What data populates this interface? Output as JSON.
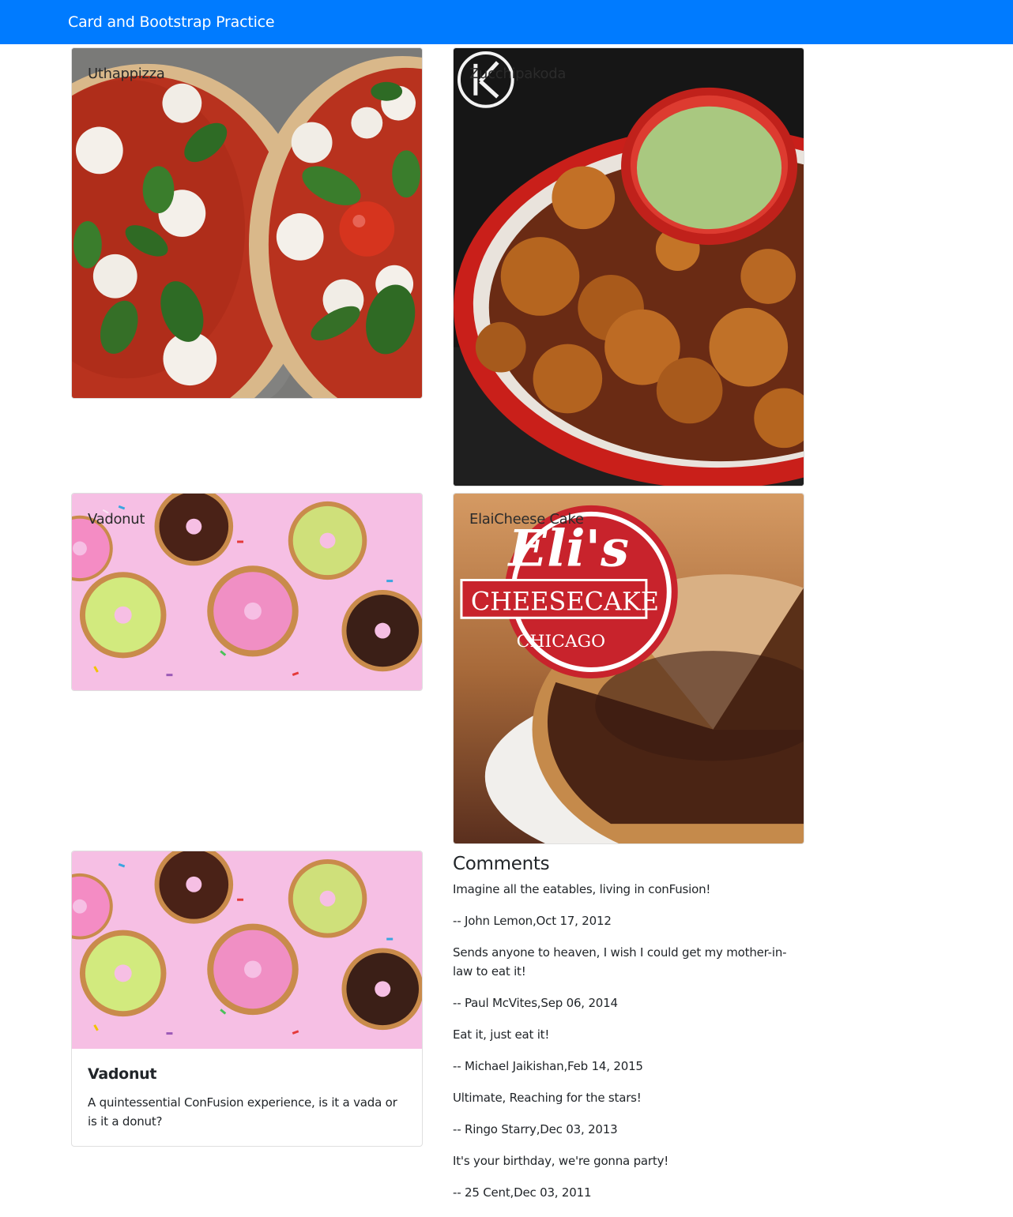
{
  "navbar": {
    "brand": "Card and Bootstrap Practice"
  },
  "cards": {
    "uthappizza": {
      "title": "Uthappizza"
    },
    "zucchipakoda": {
      "title": "Zucchipakoda"
    },
    "vadonut": {
      "title": "Vadonut"
    },
    "elaicheese": {
      "title": "ElaiCheese Cake"
    },
    "vadonut_detail": {
      "title": "Vadonut",
      "description": "A quintessential ConFusion experience, is it a vada or is it a donut?"
    }
  },
  "comments": {
    "heading": "Comments",
    "items": [
      {
        "text": "Imagine all the eatables, living in conFusion!",
        "author": "-- John Lemon,Oct 17, 2012"
      },
      {
        "text": "Sends anyone to heaven, I wish I could get my mother-in-law to eat it!",
        "author": "-- Paul McVites,Sep 06, 2014"
      },
      {
        "text": "Eat it, just eat it!",
        "author": "-- Michael Jaikishan,Feb 14, 2015"
      },
      {
        "text": "Ultimate, Reaching for the stars!",
        "author": "-- Ringo Starry,Dec 03, 2013"
      },
      {
        "text": "It's your birthday, we're gonna party!",
        "author": "-- 25 Cent,Dec 03, 2011"
      }
    ]
  },
  "images": {
    "pizza": "pizza-photo",
    "pakoda": "pakoda-photo",
    "donut": "donut-photo",
    "cheesecake": "cheesecake-photo"
  },
  "logos": {
    "cheesecake_brand_line1": "Eli's",
    "cheesecake_brand_line2": "CHEESECAKE",
    "cheesecake_brand_line3": "CHICAGO"
  },
  "colors": {
    "primary": "#007bff"
  }
}
